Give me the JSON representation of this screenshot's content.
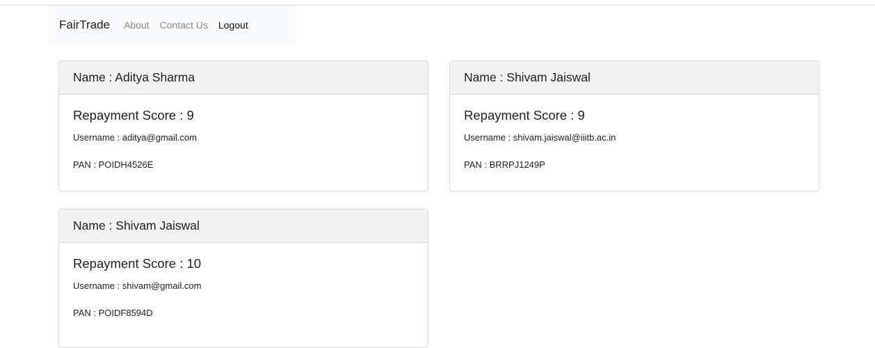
{
  "navbar": {
    "brand": "FairTrade",
    "links": [
      {
        "label": "About"
      },
      {
        "label": "Contact Us"
      },
      {
        "label": "Logout"
      }
    ]
  },
  "cards": [
    {
      "name": "Name : Aditya Sharma",
      "score": "Repayment Score : 9",
      "username": "Username : aditya@gmail.com",
      "pan": "PAN : POIDH4526E"
    },
    {
      "name": "Name : Shivam Jaiswal",
      "score": "Repayment Score : 9",
      "username": "Username : shivam.jaiswal@iiitb.ac.in",
      "pan": "PAN : BRRPJ1249P"
    },
    {
      "name": "Name : Shivam Jaiswal",
      "score": "Repayment Score : 10",
      "username": "Username : shivam@gmail.com",
      "pan": "PAN : POIDF8594D"
    }
  ]
}
